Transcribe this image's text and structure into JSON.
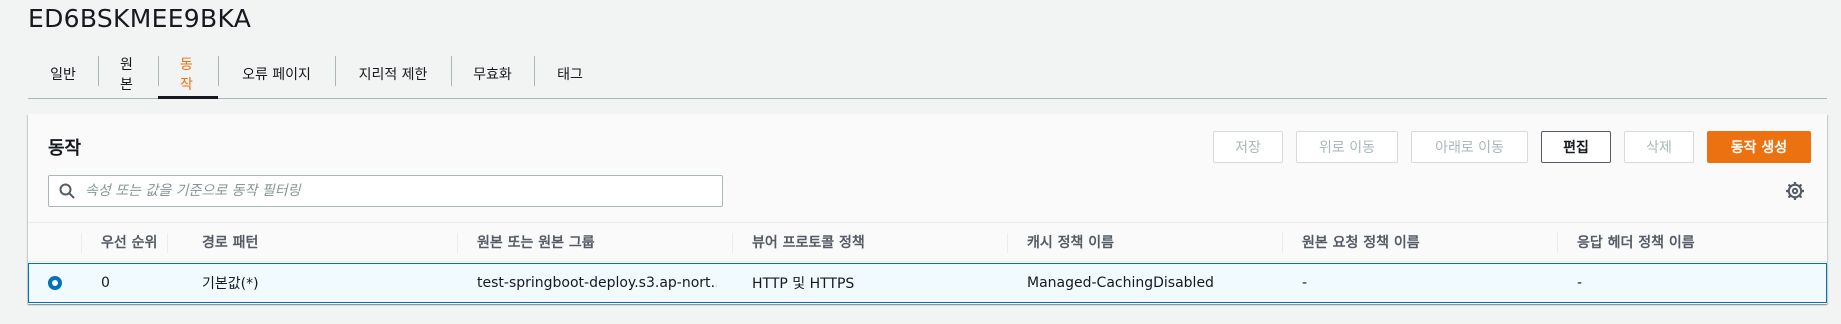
{
  "distribution": {
    "id": "ED6BSKMEE9BKA"
  },
  "tabs": [
    {
      "label": "일반"
    },
    {
      "label": "원본"
    },
    {
      "label": "동작"
    },
    {
      "label": "오류 페이지"
    },
    {
      "label": "지리적 제한"
    },
    {
      "label": "무효화"
    },
    {
      "label": "태그"
    }
  ],
  "active_tab": "동작",
  "panel": {
    "title": "동작",
    "buttons": {
      "save": "저장",
      "move_up": "위로 이동",
      "move_down": "아래로 이동",
      "edit": "편집",
      "delete": "삭제",
      "create": "동작 생성"
    },
    "search": {
      "placeholder": "속성 또는 값을 기준으로 동작 필터링",
      "value": ""
    }
  },
  "table": {
    "columns": [
      "우선 순위",
      "경로 패턴",
      "원본 또는 원본 그룹",
      "뷰어 프로토콜 정책",
      "캐시 정책 이름",
      "원본 요청 정책 이름",
      "응답 헤더 정책 이름"
    ],
    "rows": [
      {
        "selected": true,
        "cells": [
          "0",
          "기본값(*)",
          "test-springboot-deploy.s3.ap-nort…",
          "HTTP 및 HTTPS",
          "Managed-CachingDisabled",
          "-",
          "-"
        ]
      }
    ]
  },
  "colors": {
    "accent": "#ec7211",
    "selection_border": "#0073bb",
    "selection_bg": "#f1faff",
    "page_bg": "#f2f3f3"
  },
  "icons": {
    "search": "search-icon",
    "settings": "gear-icon",
    "radio": "radio-selected-icon"
  }
}
